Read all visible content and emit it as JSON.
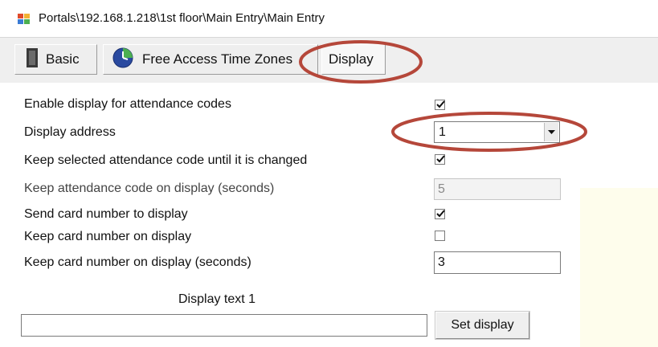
{
  "window": {
    "title": "Portals\\192.168.1.218\\1st floor\\Main Entry\\Main Entry"
  },
  "tabs": [
    {
      "label": "Basic",
      "icon": "panel-icon"
    },
    {
      "label": "Free Access Time Zones",
      "icon": "clock-icon"
    },
    {
      "label": "Display",
      "icon": ""
    }
  ],
  "active_tab": "Display",
  "settings": {
    "enable_display": {
      "label": "Enable display for attendance codes",
      "checked": true
    },
    "display_address": {
      "label": "Display address",
      "value": "1"
    },
    "keep_selected_code": {
      "label": "Keep selected attendance code until it is changed",
      "checked": true
    },
    "keep_code_seconds": {
      "label": "Keep attendance code on display (seconds)",
      "value": "5"
    },
    "send_card_number": {
      "label": "Send card number to display",
      "checked": true
    },
    "keep_card_number": {
      "label": "Keep card number on display",
      "checked": false
    },
    "keep_card_seconds": {
      "label": "Keep card number on display (seconds)",
      "value": "3"
    }
  },
  "display_text": {
    "caption": "Display text 1",
    "value": "",
    "button_label": "Set display"
  },
  "colors": {
    "annotation": "#b5473a",
    "highlight_area": "#fefdec"
  }
}
